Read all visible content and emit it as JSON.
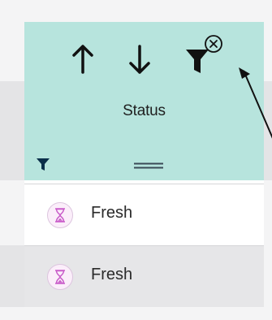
{
  "column": {
    "title": "Status",
    "header_background": "#b7e4dd",
    "toolbar": {
      "sort_ascending_icon": "arrow-up-icon",
      "sort_descending_icon": "arrow-down-icon",
      "filter_icon": "funnel-icon",
      "clear_filter_icon": "circle-x-icon"
    },
    "filter_active": true,
    "resize_handle_icon": "double-line-handle-icon"
  },
  "rows": [
    {
      "status": "Fresh",
      "icon": "hourglass-icon",
      "icon_color": "#c95cc9"
    },
    {
      "status": "Fresh",
      "icon": "hourglass-icon",
      "icon_color": "#c95cc9"
    }
  ]
}
